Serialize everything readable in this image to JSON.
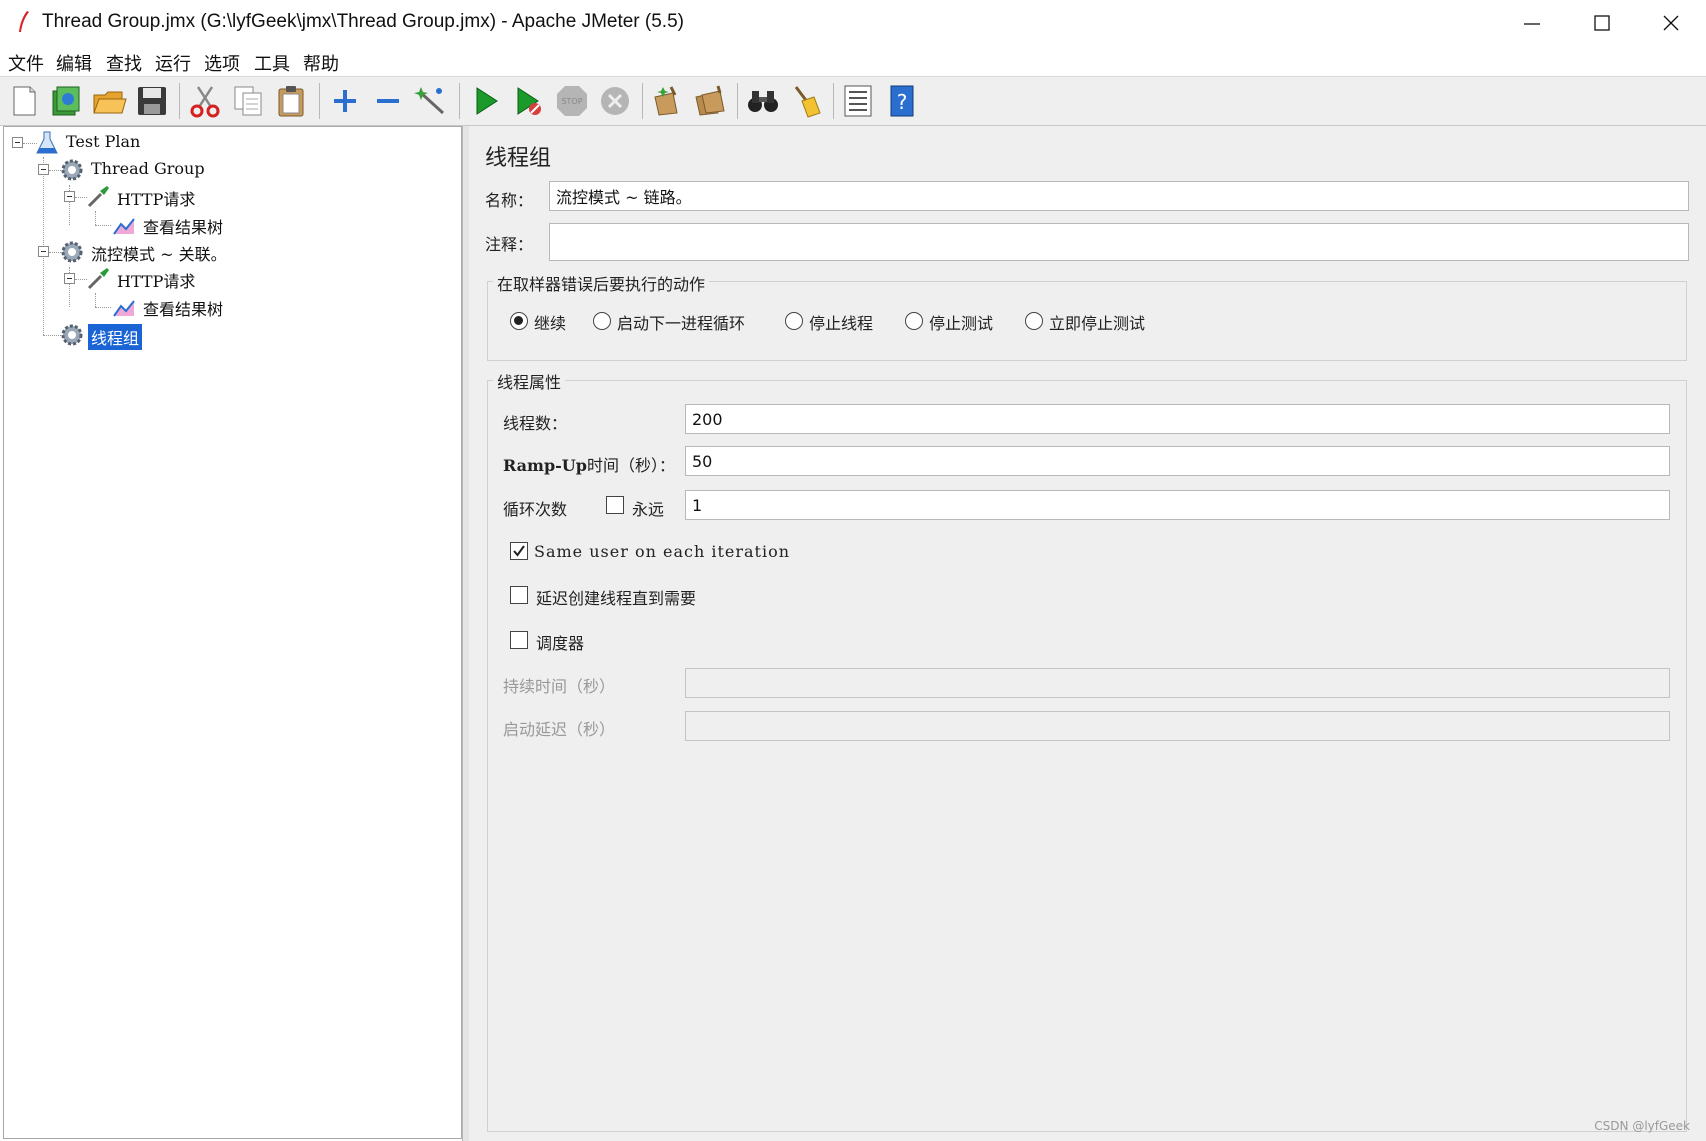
{
  "window": {
    "title": "Thread Group.jmx (G:\\lyfGeek\\jmx\\Thread Group.jmx) - Apache JMeter (5.5)"
  },
  "menu": [
    "文件",
    "编辑",
    "查找",
    "运行",
    "选项",
    "工具",
    "帮助"
  ],
  "toolbar": {
    "icons": [
      "new-icon",
      "templates-icon",
      "open-icon",
      "save-icon",
      "cut-icon",
      "copy-icon",
      "paste-icon",
      "expand-icon",
      "collapse-icon",
      "toggle-icon",
      "start-icon",
      "start-no-pause-icon",
      "stop-icon",
      "shutdown-icon",
      "clear-icon",
      "clear-all-icon",
      "search-icon",
      "reset-search-icon",
      "function-helper-icon",
      "help-icon"
    ]
  },
  "tree": {
    "test_plan": "Test Plan",
    "thread_group": "Thread Group",
    "http_request_1": "HTTP请求",
    "result_tree_1": "查看结果树",
    "flow_mode": "流控模式 ~ 关联。",
    "http_request_2": "HTTP请求",
    "result_tree_2": "查看结果树",
    "selected": "线程组"
  },
  "panel": {
    "title": "线程组",
    "name_label": "名称：",
    "name_value": "流控模式 ~ 链路。",
    "comment_label": "注释：",
    "comment_value": "",
    "error_action": {
      "title": "在取样器错误后要执行的动作",
      "options": [
        "继续",
        "启动下一进程循环",
        "停止线程",
        "停止测试",
        "立即停止测试"
      ],
      "selected": "继续"
    },
    "thread_props": {
      "title": "线程属性",
      "threads_label": "线程数：",
      "threads_value": "200",
      "rampup_label_a": "Ramp-Up",
      "rampup_label_b": "时间（秒）：",
      "rampup_value": "50",
      "loop_label": "循环次数",
      "forever_label": "永远",
      "forever_checked": false,
      "loop_value": "1",
      "same_user_label": "Same user on each iteration",
      "same_user_checked": true,
      "delay_label": "延迟创建线程直到需要",
      "delay_checked": false,
      "scheduler_label": "调度器",
      "scheduler_checked": false,
      "duration_label": "持续时间（秒）",
      "duration_value": "",
      "startup_delay_label": "启动延迟（秒）",
      "startup_delay_value": ""
    }
  },
  "watermark": "CSDN @lyfGeek"
}
